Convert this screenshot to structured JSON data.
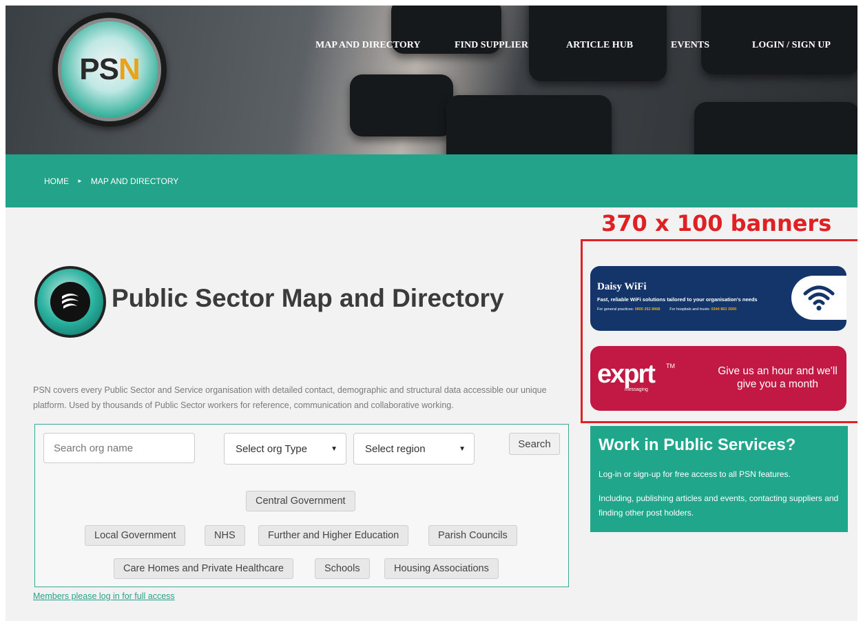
{
  "header": {
    "logo_text": "PSN",
    "nav": [
      {
        "label": "MAP AND DIRECTORY"
      },
      {
        "label": "FIND SUPPLIER"
      },
      {
        "label": "ARTICLE HUB"
      },
      {
        "label": "EVENTS"
      },
      {
        "label": "LOGIN / SIGN UP"
      }
    ]
  },
  "breadcrumb": {
    "home": "HOME",
    "separator": "►",
    "current": "MAP AND DIRECTORY"
  },
  "main": {
    "title": "Public Sector Map and Directory",
    "intro": "PSN covers every Public Sector and Service organisation with detailed contact, demographic and structural data accessible our unique platform. Used by thousands of Public Sector workers for reference, communication and collaborative working.",
    "search": {
      "placeholder": "Search org name",
      "org_type": "Select org Type",
      "region": "Select region",
      "button": "Search"
    },
    "categories": [
      "Central Government",
      "Local Government",
      "NHS",
      "Further and Higher Education",
      "Parish Councils",
      "Care Homes and Private Healthcare",
      "Schools",
      "Housing Associations"
    ],
    "members_link": "Members please log in for full access"
  },
  "sidebar": {
    "annotation": "370 x 100 banners",
    "daisy": {
      "title": "Daisy WiFi",
      "subtitle": "Fast, reliable WiFi solutions tailored to your organisation's needs",
      "gp_label": "For general practices:",
      "gp_phone": "0800 252 8968",
      "hosp_label": "For hospitals and trusts:",
      "hosp_phone": "0344 863 3000"
    },
    "expert": {
      "logo": "exprt",
      "tm": "TM",
      "sub": "messaging",
      "tagline": "Give us an hour and we'll give you a month"
    },
    "work": {
      "heading": "Work in Public Services?",
      "p1": "Log-in or sign-up for free access to all PSN features.",
      "p2": "Including, publishing articles and events, contacting suppliers and finding other post holders."
    }
  },
  "colors": {
    "teal": "#22a38a",
    "annotation_red": "#e02124",
    "daisy_blue": "#13356a",
    "expert_red": "#c21844"
  }
}
